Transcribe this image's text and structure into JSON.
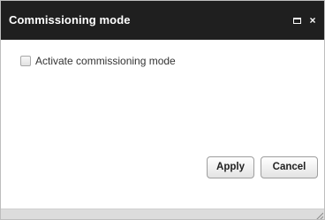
{
  "dialog": {
    "title": "Commissioning mode",
    "controls": {
      "maximize_icon": "maximize-icon",
      "close_symbol": "×"
    }
  },
  "form": {
    "checkbox_label": "Activate commissioning mode",
    "checkbox_checked": false
  },
  "buttons": {
    "apply_label": "Apply",
    "cancel_label": "Cancel"
  },
  "colors": {
    "titlebar": "#1f1f1f",
    "title_text": "#ffffff",
    "footer": "#dcdcdc"
  }
}
